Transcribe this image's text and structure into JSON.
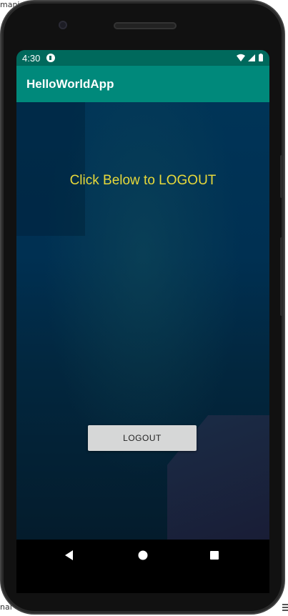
{
  "ide": {
    "top_fragment": "mani",
    "bottom_fragment": "nal"
  },
  "status_bar": {
    "time": "4:30",
    "colors": {
      "background": "#00695c",
      "text": "#ffffff"
    },
    "icons": [
      "app-notification-icon",
      "wifi-icon",
      "cellular-signal-icon",
      "battery-icon"
    ]
  },
  "app_bar": {
    "title": "HelloWorldApp",
    "colors": {
      "background": "#00897b",
      "title": "#ffffff"
    }
  },
  "main": {
    "instruction_text": "Click Below to LOGOUT",
    "logout_button_label": "LOGOUT",
    "colors": {
      "instruction": "#e8d93a",
      "button_bg": "#d6d7d7",
      "background": "#00304f"
    }
  },
  "nav_bar": {
    "items": [
      {
        "name": "back",
        "icon": "triangle-back-icon"
      },
      {
        "name": "home",
        "icon": "circle-home-icon"
      },
      {
        "name": "recents",
        "icon": "square-recents-icon"
      }
    ]
  }
}
